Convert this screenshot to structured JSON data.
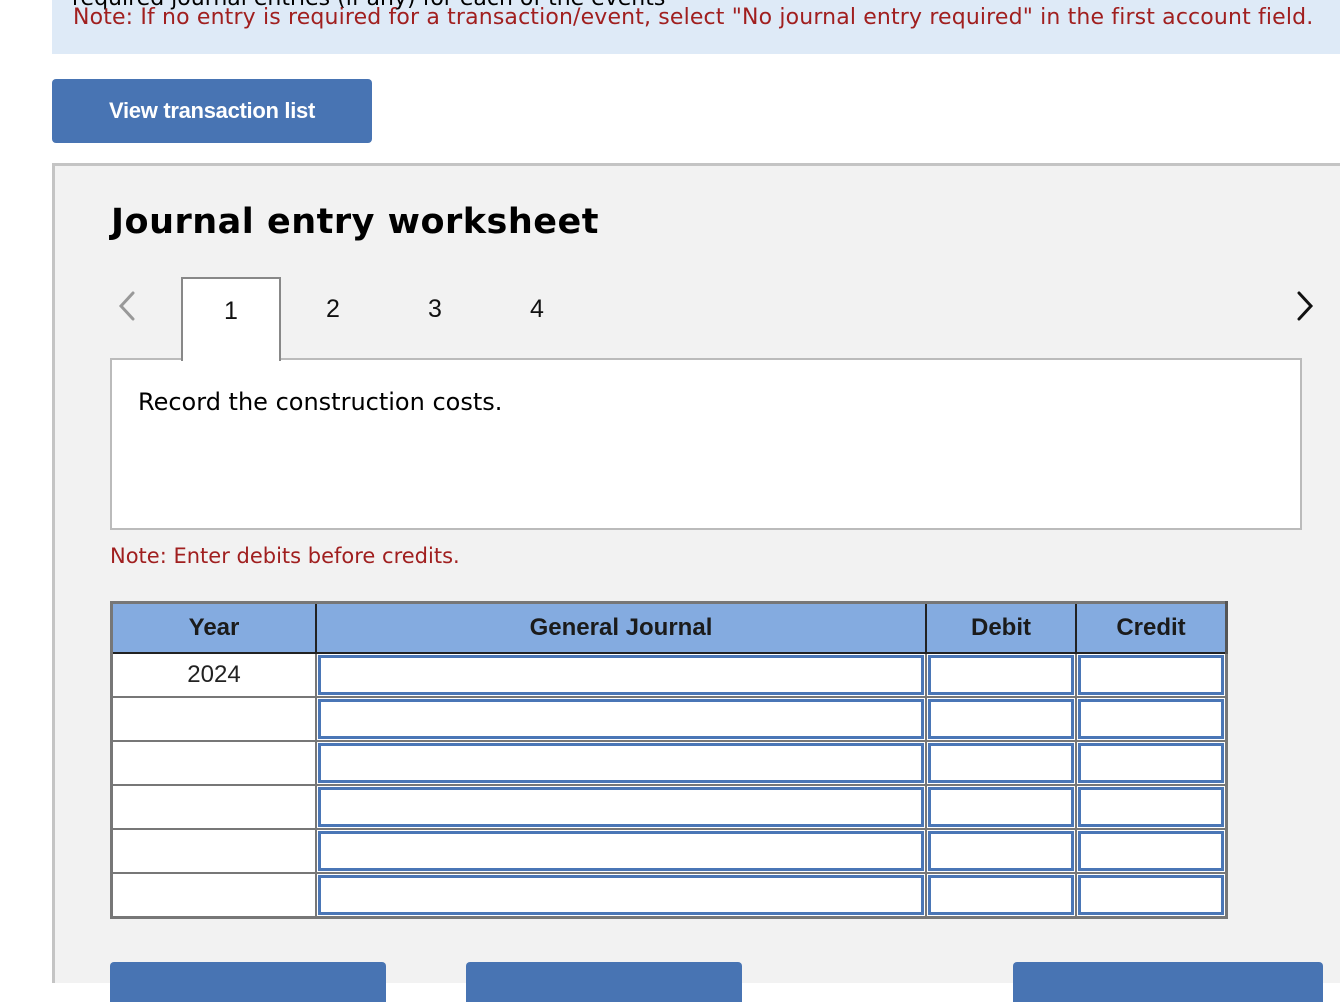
{
  "banner": {
    "clipped_text": "required journal entries (if any) for each of the events",
    "note": "Note: If no entry is required for a transaction/event, select \"No journal entry required\" in the first account field."
  },
  "view_transaction_list_label": "View transaction list",
  "worksheet": {
    "title": "Journal entry worksheet",
    "prev_icon": "chevron-left-icon",
    "next_icon": "chevron-right-icon",
    "tabs": [
      {
        "label": "1",
        "active": true
      },
      {
        "label": "2",
        "active": false
      },
      {
        "label": "3",
        "active": false
      },
      {
        "label": "4",
        "active": false
      }
    ],
    "description": "Record the construction costs.",
    "note": "Note: Enter debits before credits.",
    "table": {
      "headers": [
        "Year",
        "General Journal",
        "Debit",
        "Credit"
      ],
      "rows": [
        {
          "year": "2024",
          "account": "",
          "debit": "",
          "credit": ""
        },
        {
          "year": "",
          "account": "",
          "debit": "",
          "credit": ""
        },
        {
          "year": "",
          "account": "",
          "debit": "",
          "credit": ""
        },
        {
          "year": "",
          "account": "",
          "debit": "",
          "credit": ""
        },
        {
          "year": "",
          "account": "",
          "debit": "",
          "credit": ""
        },
        {
          "year": "",
          "account": "",
          "debit": "",
          "credit": ""
        }
      ]
    }
  },
  "colors": {
    "accent_blue": "#4874b3",
    "header_blue": "#84abe0",
    "note_red": "#a01f1f",
    "banner_bg": "#deeaf7"
  }
}
